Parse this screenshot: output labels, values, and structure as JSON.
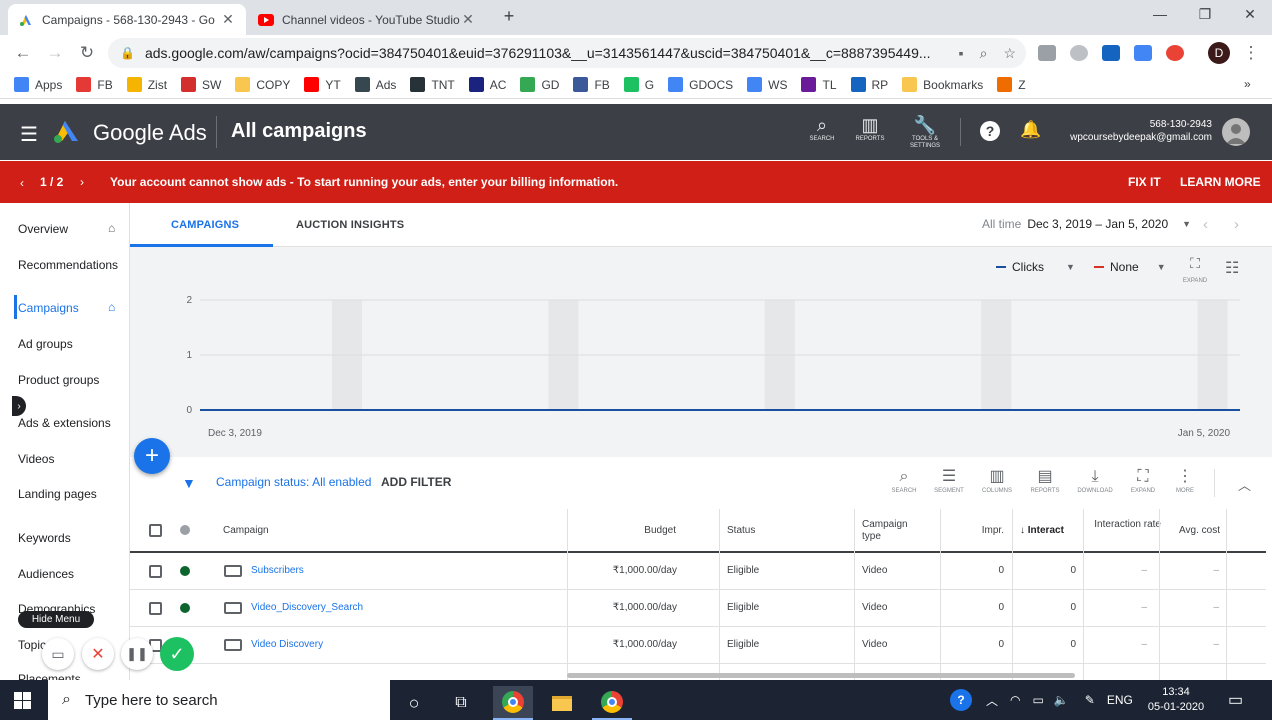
{
  "browser": {
    "tabs": [
      {
        "title": "Campaigns - 568-130-2943 - Go",
        "favicon": "google-ads-icon",
        "active": true
      },
      {
        "title": "Channel videos - YouTube Studio",
        "favicon": "youtube-icon",
        "active": false
      }
    ],
    "url": "ads.google.com/aw/campaigns?ocid=384750401&euid=376291103&__u=3143561447&uscid=384750401&__c=8887395449...",
    "profile_initial": "D",
    "bookmarks": [
      {
        "label": "Apps",
        "color": "#4285f4"
      },
      {
        "label": "FB",
        "color": "#e53935"
      },
      {
        "label": "Zist",
        "color": "#f4b400"
      },
      {
        "label": "SW",
        "color": "#d32f2f"
      },
      {
        "label": "COPY",
        "color": "#f9c74f"
      },
      {
        "label": "YT",
        "color": "#ff0000"
      },
      {
        "label": "Ads",
        "color": "#37474f"
      },
      {
        "label": "TNT",
        "color": "#263238"
      },
      {
        "label": "AC",
        "color": "#1a237e"
      },
      {
        "label": "GD",
        "color": "#34a853"
      },
      {
        "label": "FB",
        "color": "#3b5998"
      },
      {
        "label": "G",
        "color": "#1ec162"
      },
      {
        "label": "GDOCS",
        "color": "#4285f4"
      },
      {
        "label": "WS",
        "color": "#4285f4"
      },
      {
        "label": "TL",
        "color": "#6a1b9a"
      },
      {
        "label": "RP",
        "color": "#1565c0"
      },
      {
        "label": "Bookmarks",
        "color": "#f9c74f"
      },
      {
        "label": "Z",
        "color": "#ef6c00"
      }
    ],
    "bookmarks_more": "»"
  },
  "ads_header": {
    "brand": "Google Ads",
    "page_title": "All campaigns",
    "tools": [
      {
        "label": "SEARCH",
        "icon": "search-icon"
      },
      {
        "label": "REPORTS",
        "icon": "reports-icon"
      },
      {
        "label": "TOOLS & SETTINGS",
        "icon": "wrench-icon"
      }
    ],
    "account_id": "568-130-2943",
    "account_email": "wpcoursebydeepak@gmail.com"
  },
  "banner": {
    "counter": "1 / 2",
    "message": "Your account cannot show ads - To start running your ads, enter your billing information.",
    "fix": "FIX IT",
    "learn": "LEARN MORE",
    "color": "#d01f17"
  },
  "sidebar": {
    "items": [
      {
        "label": "Overview",
        "home": true
      },
      {
        "label": "Recommendations",
        "home": false
      },
      {
        "label": "Campaigns",
        "home": true,
        "selected": true
      },
      {
        "label": "Ad groups",
        "home": false
      },
      {
        "label": "Product groups",
        "home": false
      },
      {
        "label": "Ads & extensions",
        "home": false
      },
      {
        "label": "Videos",
        "home": false
      },
      {
        "label": "Landing pages",
        "home": false
      },
      {
        "label": "Keywords",
        "home": false
      },
      {
        "label": "Audiences",
        "home": false
      },
      {
        "label": "Demographics",
        "home": false
      },
      {
        "label": "Topics",
        "home": false
      },
      {
        "label": "Placements",
        "home": false
      }
    ]
  },
  "main": {
    "tabs": [
      "CAMPAIGNS",
      "AUCTION INSIGHTS"
    ],
    "date_label": "All time",
    "date_range": "Dec 3, 2019 – Jan 5, 2020",
    "metric1": "Clicks",
    "metric2": "None",
    "expand_label": "EXPAND"
  },
  "chart_data": {
    "type": "line",
    "x_start_label": "Dec 3, 2019",
    "x_end_label": "Jan 5, 2020",
    "yticks": [
      0,
      1,
      2
    ],
    "ylim": [
      0,
      2
    ],
    "series": [
      {
        "name": "Clicks",
        "values": [
          0,
          0,
          0,
          0,
          0,
          0,
          0,
          0,
          0,
          0,
          0,
          0,
          0,
          0,
          0,
          0,
          0,
          0,
          0,
          0,
          0,
          0,
          0,
          0,
          0,
          0,
          0,
          0,
          0,
          0,
          0,
          0,
          0,
          0
        ]
      }
    ],
    "weekend_bands": 6,
    "color": "#1a4fa0"
  },
  "filter": {
    "prefix": "Campaign status:",
    "value": "All enabled",
    "add": "ADD FILTER"
  },
  "table_tools": [
    "SEARCH",
    "SEGMENT",
    "COLUMNS",
    "REPORTS",
    "DOWNLOAD",
    "EXPAND",
    "MORE"
  ],
  "table": {
    "headers": {
      "campaign": "Campaign",
      "budget": "Budget",
      "status": "Status",
      "type": "Campaign type",
      "impr": "Impr.",
      "interactions": "↓ Interact",
      "interaction_rate": "Interaction rate",
      "avg_cost": "Avg. cost"
    },
    "rows": [
      {
        "name": "Subscribers",
        "budget": "₹1,000.00/day",
        "status": "Eligible",
        "type": "Video",
        "impr": "0",
        "interactions": "0",
        "rate": "–",
        "avg_cost": "–"
      },
      {
        "name": "Video_Discovery_Search",
        "budget": "₹1,000.00/day",
        "status": "Eligible",
        "type": "Video",
        "impr": "0",
        "interactions": "0",
        "rate": "–",
        "avg_cost": "–"
      },
      {
        "name": "Video Discovery",
        "budget": "₹1,000.00/day",
        "status": "Eligible",
        "type": "Video",
        "impr": "0",
        "interactions": "0",
        "rate": "–",
        "avg_cost": "–"
      }
    ]
  },
  "recorder": {
    "hide_menu": "Hide Menu"
  },
  "taskbar": {
    "search_placeholder": "Type here to search",
    "lang": "ENG",
    "time": "13:34",
    "date": "05-01-2020"
  }
}
